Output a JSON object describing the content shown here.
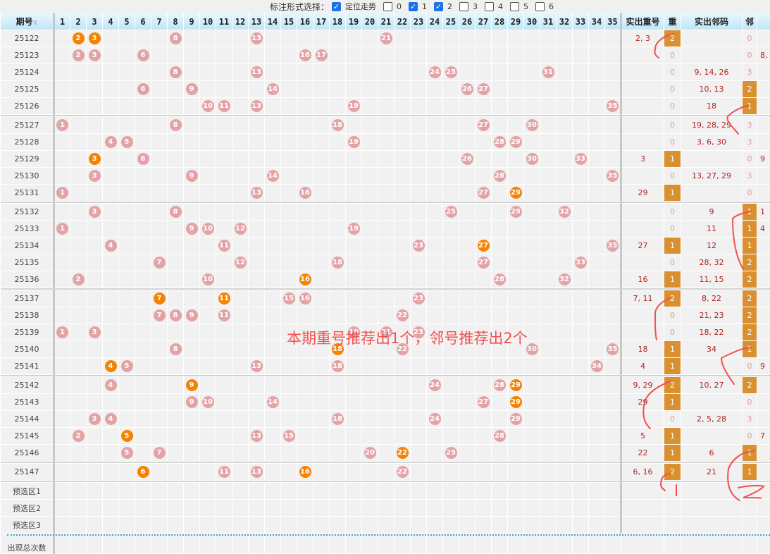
{
  "toolbar": {
    "label": "标注形式选择：",
    "options": [
      {
        "label": "定位走势",
        "checked": true
      },
      {
        "label": "0",
        "checked": false
      },
      {
        "label": "1",
        "checked": true
      },
      {
        "label": "2",
        "checked": true
      },
      {
        "label": "3",
        "checked": false
      },
      {
        "label": "4",
        "checked": false
      },
      {
        "label": "5",
        "checked": false
      },
      {
        "label": "6",
        "checked": false
      }
    ]
  },
  "header": {
    "period": "期号",
    "sort_icon": "sort-icon",
    "numbers": [
      "1",
      "2",
      "3",
      "4",
      "5",
      "6",
      "7",
      "8",
      "9",
      "10",
      "11",
      "12",
      "13",
      "14",
      "15",
      "16",
      "17",
      "18",
      "19",
      "20",
      "21",
      "22",
      "23",
      "24",
      "25",
      "26",
      "27",
      "28",
      "29",
      "30",
      "31",
      "32",
      "33",
      "34",
      "35"
    ],
    "repeat_actual": "实出重号",
    "repeat": "重",
    "neighbor_actual": "实出邻码",
    "neighbor": "邻"
  },
  "rows": [
    {
      "period": "25122",
      "balls": [
        2,
        3,
        8,
        13,
        21
      ],
      "hot": [
        2,
        3
      ],
      "repeat_actual": "2, 3",
      "repeat": "2",
      "neighbor_actual": "",
      "neighbor": "0",
      "extra": ""
    },
    {
      "period": "25123",
      "balls": [
        2,
        3,
        6,
        16,
        17
      ],
      "hot": [],
      "repeat_actual": "",
      "repeat": "0",
      "neighbor_actual": "",
      "neighbor": "0",
      "extra": "8,"
    },
    {
      "period": "25124",
      "balls": [
        8,
        13,
        24,
        25,
        31
      ],
      "hot": [],
      "repeat_actual": "",
      "repeat": "0",
      "neighbor_actual": "9, 14, 26",
      "neighbor": "3",
      "extra": ""
    },
    {
      "period": "25125",
      "balls": [
        6,
        9,
        14,
        26,
        27
      ],
      "hot": [],
      "repeat_actual": "",
      "repeat": "0",
      "neighbor_actual": "10, 13",
      "neighbor": "2",
      "extra": ""
    },
    {
      "period": "25126",
      "balls": [
        10,
        11,
        13,
        19,
        35
      ],
      "hot": [],
      "repeat_actual": "",
      "repeat": "0",
      "neighbor_actual": "18",
      "neighbor": "1",
      "extra": ""
    },
    {
      "period": "25127",
      "balls": [
        1,
        8,
        18,
        27,
        30
      ],
      "hot": [],
      "repeat_actual": "",
      "repeat": "0",
      "neighbor_actual": "19, 28, 29",
      "neighbor": "3",
      "extra": ""
    },
    {
      "period": "25128",
      "balls": [
        4,
        5,
        19,
        28,
        29
      ],
      "hot": [],
      "repeat_actual": "",
      "repeat": "0",
      "neighbor_actual": "3, 6, 30",
      "neighbor": "3",
      "extra": ""
    },
    {
      "period": "25129",
      "balls": [
        3,
        6,
        26,
        30,
        33
      ],
      "hot": [
        3
      ],
      "repeat_actual": "3",
      "repeat": "1",
      "neighbor_actual": "",
      "neighbor": "0",
      "extra": "9"
    },
    {
      "period": "25130",
      "balls": [
        3,
        9,
        14,
        28,
        35
      ],
      "hot": [],
      "repeat_actual": "",
      "repeat": "0",
      "neighbor_actual": "13, 27, 29",
      "neighbor": "3",
      "extra": ""
    },
    {
      "period": "25131",
      "balls": [
        1,
        13,
        16,
        27,
        29
      ],
      "hot": [
        29
      ],
      "repeat_actual": "29",
      "repeat": "1",
      "neighbor_actual": "",
      "neighbor": "0",
      "extra": ""
    },
    {
      "period": "25132",
      "balls": [
        3,
        8,
        25,
        29,
        32
      ],
      "hot": [],
      "repeat_actual": "",
      "repeat": "0",
      "neighbor_actual": "9",
      "neighbor": "1",
      "extra": "1"
    },
    {
      "period": "25133",
      "balls": [
        1,
        9,
        10,
        12,
        19
      ],
      "hot": [],
      "repeat_actual": "",
      "repeat": "0",
      "neighbor_actual": "11",
      "neighbor": "1",
      "extra": "4"
    },
    {
      "period": "25134",
      "balls": [
        4,
        11,
        23,
        27,
        35
      ],
      "hot": [
        27
      ],
      "repeat_actual": "27",
      "repeat": "1",
      "neighbor_actual": "12",
      "neighbor": "1",
      "extra": ""
    },
    {
      "period": "25135",
      "balls": [
        7,
        12,
        18,
        27,
        33
      ],
      "hot": [],
      "repeat_actual": "",
      "repeat": "0",
      "neighbor_actual": "28, 32",
      "neighbor": "2",
      "extra": ""
    },
    {
      "period": "25136",
      "balls": [
        2,
        10,
        16,
        28,
        32
      ],
      "hot": [
        16
      ],
      "repeat_actual": "16",
      "repeat": "1",
      "neighbor_actual": "11, 15",
      "neighbor": "2",
      "extra": ""
    },
    {
      "period": "25137",
      "balls": [
        7,
        11,
        15,
        16,
        23
      ],
      "hot": [
        7,
        11
      ],
      "repeat_actual": "7, 11",
      "repeat": "2",
      "neighbor_actual": "8, 22",
      "neighbor": "2",
      "extra": ""
    },
    {
      "period": "25138",
      "balls": [
        7,
        8,
        9,
        11,
        22
      ],
      "hot": [],
      "repeat_actual": "",
      "repeat": "0",
      "neighbor_actual": "21, 23",
      "neighbor": "2",
      "extra": ""
    },
    {
      "period": "25139",
      "balls": [
        1,
        3,
        19,
        21,
        23
      ],
      "hot": [],
      "repeat_actual": "",
      "repeat": "0",
      "neighbor_actual": "18, 22",
      "neighbor": "2",
      "extra": ""
    },
    {
      "period": "25140",
      "balls": [
        8,
        18,
        22,
        30,
        35
      ],
      "hot": [
        18
      ],
      "repeat_actual": "18",
      "repeat": "1",
      "neighbor_actual": "34",
      "neighbor": "1",
      "extra": ""
    },
    {
      "period": "25141",
      "balls": [
        4,
        5,
        13,
        18,
        34
      ],
      "hot": [
        4
      ],
      "repeat_actual": "4",
      "repeat": "1",
      "neighbor_actual": "",
      "neighbor": "0",
      "extra": "9"
    },
    {
      "period": "25142",
      "balls": [
        4,
        9,
        24,
        28,
        29
      ],
      "hot": [
        9,
        29
      ],
      "repeat_actual": "9, 29",
      "repeat": "2",
      "neighbor_actual": "10, 27",
      "neighbor": "2",
      "extra": ""
    },
    {
      "period": "25143",
      "balls": [
        9,
        10,
        14,
        27,
        29
      ],
      "hot": [
        29
      ],
      "repeat_actual": "29",
      "repeat": "1",
      "neighbor_actual": "",
      "neighbor": "0",
      "extra": ""
    },
    {
      "period": "25144",
      "balls": [
        3,
        4,
        18,
        24,
        29
      ],
      "hot": [],
      "repeat_actual": "",
      "repeat": "0",
      "neighbor_actual": "2, 5, 28",
      "neighbor": "3",
      "extra": ""
    },
    {
      "period": "25145",
      "balls": [
        2,
        5,
        13,
        15,
        28
      ],
      "hot": [
        5
      ],
      "repeat_actual": "5",
      "repeat": "1",
      "neighbor_actual": "",
      "neighbor": "0",
      "extra": "7"
    },
    {
      "period": "25146",
      "balls": [
        5,
        7,
        20,
        22,
        25
      ],
      "hot": [
        22
      ],
      "repeat_actual": "22",
      "repeat": "1",
      "neighbor_actual": "6",
      "neighbor": "1",
      "extra": ""
    },
    {
      "period": "25147",
      "balls": [
        6,
        11,
        13,
        16,
        22
      ],
      "hot": [
        6,
        16
      ],
      "repeat_actual": "6, 16",
      "repeat": "2",
      "neighbor_actual": "21",
      "neighbor": "1",
      "extra": ""
    }
  ],
  "preselect": [
    "预选区1",
    "预选区2",
    "预选区3"
  ],
  "footer_label": "出现总次数",
  "annotation": "本期重号推荐出1个，邻号推荐出2个",
  "colors": {
    "hot": "#f58200",
    "ball": "#e3a3a6",
    "box": "#d89030",
    "annotation": "#f25050"
  }
}
